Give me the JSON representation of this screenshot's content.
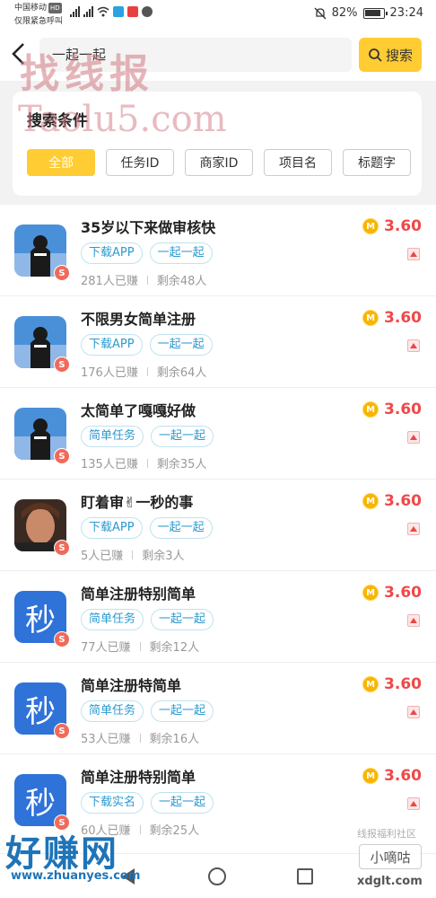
{
  "status_bar": {
    "carrier": "中国移动",
    "hd": "HD",
    "sub": "仅限紧急呼叫",
    "battery": "82%",
    "time": "23:24"
  },
  "header": {
    "back_icon": "back-arrow-icon",
    "search_value": "一起一起",
    "search_button": "搜索"
  },
  "filter": {
    "title": "搜索条件",
    "chips": [
      "全部",
      "任务ID",
      "商家ID",
      "项目名",
      "标题字"
    ],
    "active_index": 0
  },
  "tasks": [
    {
      "title": "35岁以下来做审核快",
      "tags": [
        "下载APP",
        "一起一起"
      ],
      "earned": "281人已赚",
      "remaining": "剩余48人",
      "price": "3.60",
      "avatar": "photo-dark",
      "badge": "S"
    },
    {
      "title": "不限男女简单注册",
      "tags": [
        "下载APP",
        "一起一起"
      ],
      "earned": "176人已赚",
      "remaining": "剩余64人",
      "price": "3.60",
      "avatar": "photo-dark",
      "badge": "S"
    },
    {
      "title": "太简单了嘎嘎好做",
      "tags": [
        "简单任务",
        "一起一起"
      ],
      "earned": "135人已赚",
      "remaining": "剩余35人",
      "price": "3.60",
      "avatar": "photo-dark",
      "badge": "S"
    },
    {
      "title": "盯着审✌一秒的事",
      "tags": [
        "下载APP",
        "一起一起"
      ],
      "earned": "5人已赚",
      "remaining": "剩余3人",
      "price": "3.60",
      "avatar": "photo-face",
      "badge": "S"
    },
    {
      "title": "简单注册特别简单",
      "tags": [
        "简单任务",
        "一起一起"
      ],
      "earned": "77人已赚",
      "remaining": "剩余12人",
      "price": "3.60",
      "avatar": "miao",
      "avatar_text": "秒",
      "badge": "S"
    },
    {
      "title": "简单注册特简单",
      "tags": [
        "简单任务",
        "一起一起"
      ],
      "earned": "53人已赚",
      "remaining": "剩余16人",
      "price": "3.60",
      "avatar": "miao",
      "avatar_text": "秒",
      "badge": "S"
    },
    {
      "title": "简单注册特别简单",
      "tags": [
        "下载实名",
        "一起一起"
      ],
      "earned": "60人已赚",
      "remaining": "剩余25人",
      "price": "3.60",
      "avatar": "miao",
      "avatar_text": "秒",
      "badge": "S"
    }
  ],
  "coin_label": "M",
  "watermarks": {
    "top": "找线报",
    "site": "Taolu5.com",
    "bottom": "好赚网",
    "bottom_url": "www.zhuanyes.com",
    "right_tag": "线报福利社区",
    "right_box": "小嘀咕",
    "right_url": "xdglt.com"
  },
  "colors": {
    "accent": "#ffcc33",
    "price": "#f04848",
    "tag": "#2c9ad0",
    "miao_bg": "#2f72d8"
  }
}
